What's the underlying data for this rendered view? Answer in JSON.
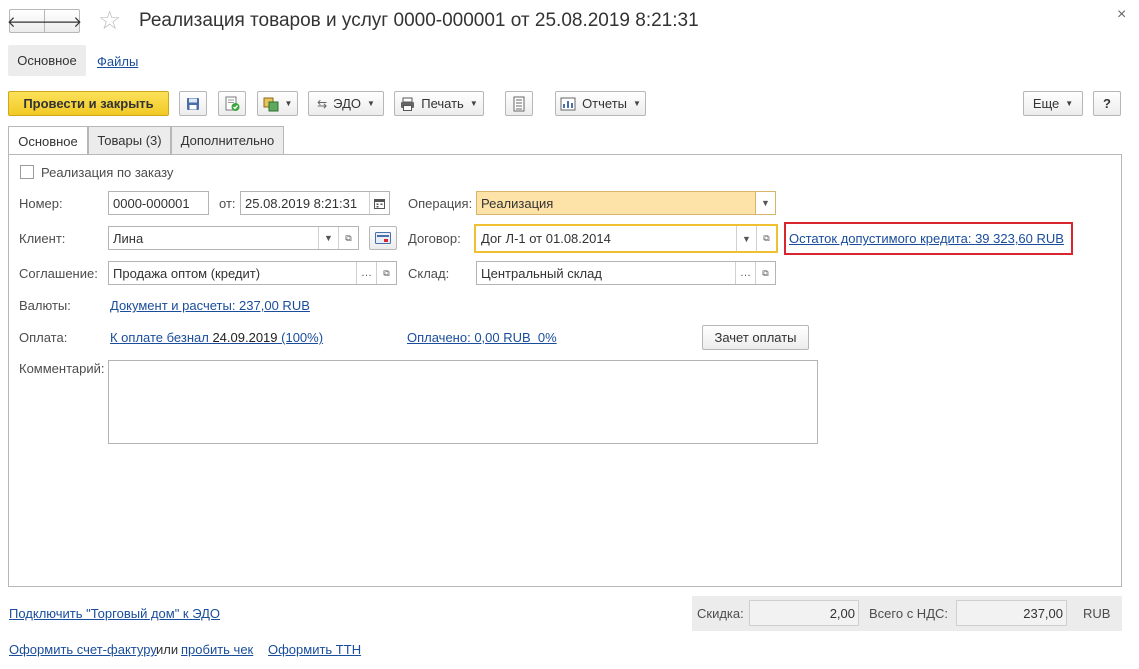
{
  "window": {
    "title": "Реализация товаров и услуг 0000-000001 от 25.08.2019 8:21:31",
    "close_glyph": "×"
  },
  "nav": {
    "back_glyph": "🡐",
    "forward_glyph": "🡒",
    "star_glyph": "☆"
  },
  "section_tabs": [
    {
      "label": "Основное"
    },
    {
      "label": "Файлы"
    }
  ],
  "toolbar": {
    "post_close_label": "Провести и закрыть",
    "edo_label": "ЭДО",
    "print_label": "Печать",
    "reports_label": "Отчеты",
    "more_label": "Еще",
    "help_label": "?"
  },
  "tabs": [
    {
      "label": "Основное"
    },
    {
      "label": "Товары (3)"
    },
    {
      "label": "Дополнительно"
    }
  ],
  "form": {
    "by_order_label": "Реализация по заказу",
    "number_label": "Номер:",
    "number_value": "0000-000001",
    "from_label": "от:",
    "date_value": "25.08.2019  8:21:31",
    "operation_label": "Операция:",
    "operation_value": "Реализация",
    "client_label": "Клиент:",
    "client_value": "Лина",
    "contract_label": "Договор:",
    "contract_value": "Дог Л-1 от 01.08.2014",
    "credit_link": "Остаток допустимого кредита: 39 323,60 RUB",
    "agreement_label": "Соглашение:",
    "agreement_value": "Продажа оптом (кредит)",
    "warehouse_label": "Склад:",
    "warehouse_value": "Центральный склад",
    "currency_label": "Валюты:",
    "currency_link": "Документ и расчеты: 237,00 RUB",
    "payment_label": "Оплата:",
    "payment_link_prefix": "К оплате безнал ",
    "payment_link_date": "24.09.2019",
    "payment_link_suffix": " (100%)",
    "paid_link": "Оплачено: 0,00 RUB  0%",
    "offset_button": "Зачет оплаты",
    "comment_label": "Комментарий:",
    "comment_value": ""
  },
  "footer": {
    "connect_link": "Подключить \"Торговый дом\" к ЭДО",
    "invoice_link": "Оформить счет-фактуру",
    "or_text": "или",
    "receipt_link": "пробить чек",
    "ttn_link": "Оформить ТТН",
    "discount_label": "Скидка:",
    "discount_value": "2,00",
    "total_label": "Всего с НДС:",
    "total_value": "237,00",
    "currency": "RUB"
  },
  "colors": {
    "accent_yellow": "#f5d23a",
    "highlight_field": "#fde3a7",
    "focus_border": "#f0c030",
    "alert_border": "#d9252e",
    "link": "#1a4d9c"
  }
}
